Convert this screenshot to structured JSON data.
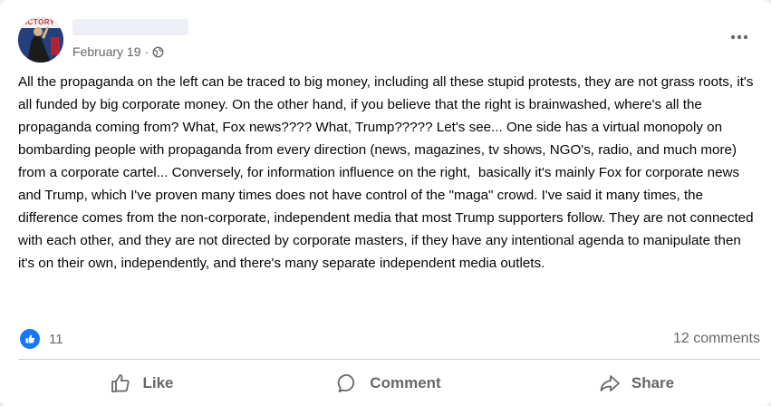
{
  "post": {
    "avatar_text": "VICTORY",
    "date": "February 19",
    "separator": "·",
    "body": "All the propaganda on the left can be traced to big money, including all these stupid protests, they are not grass roots, it's all funded by big corporate money. On the other hand, if you believe that the right is brainwashed, where's all the propaganda coming from? What, Fox news???? What, Trump????? Let's see... One side has a virtual monopoly on bombarding people with propaganda from every direction (news, magazines, tv shows, NGO's, radio, and much more) from a corporate cartel... Conversely, for information influence on the right,  basically it's mainly Fox for corporate news and Trump, which I've proven many times does not have control of the \"maga\" crowd. I've said it many times, the difference comes from the non-corporate, independent media that most Trump supporters follow. They are not connected with each other, and they are not directed by corporate masters, if they have any intentional agenda to manipulate then it's on their own, independently, and there's many separate independent media outlets."
  },
  "stats": {
    "reaction_count": "11",
    "comments": "12 comments"
  },
  "actions": {
    "like": "Like",
    "comment": "Comment",
    "share": "Share"
  },
  "icons": {
    "privacy": "globe-icon",
    "menu": "more-options-icon",
    "reaction": "thumbs-up-icon"
  },
  "colors": {
    "accent": "#1877f2",
    "secondary_text": "#65676b",
    "primary_text": "#050505"
  }
}
